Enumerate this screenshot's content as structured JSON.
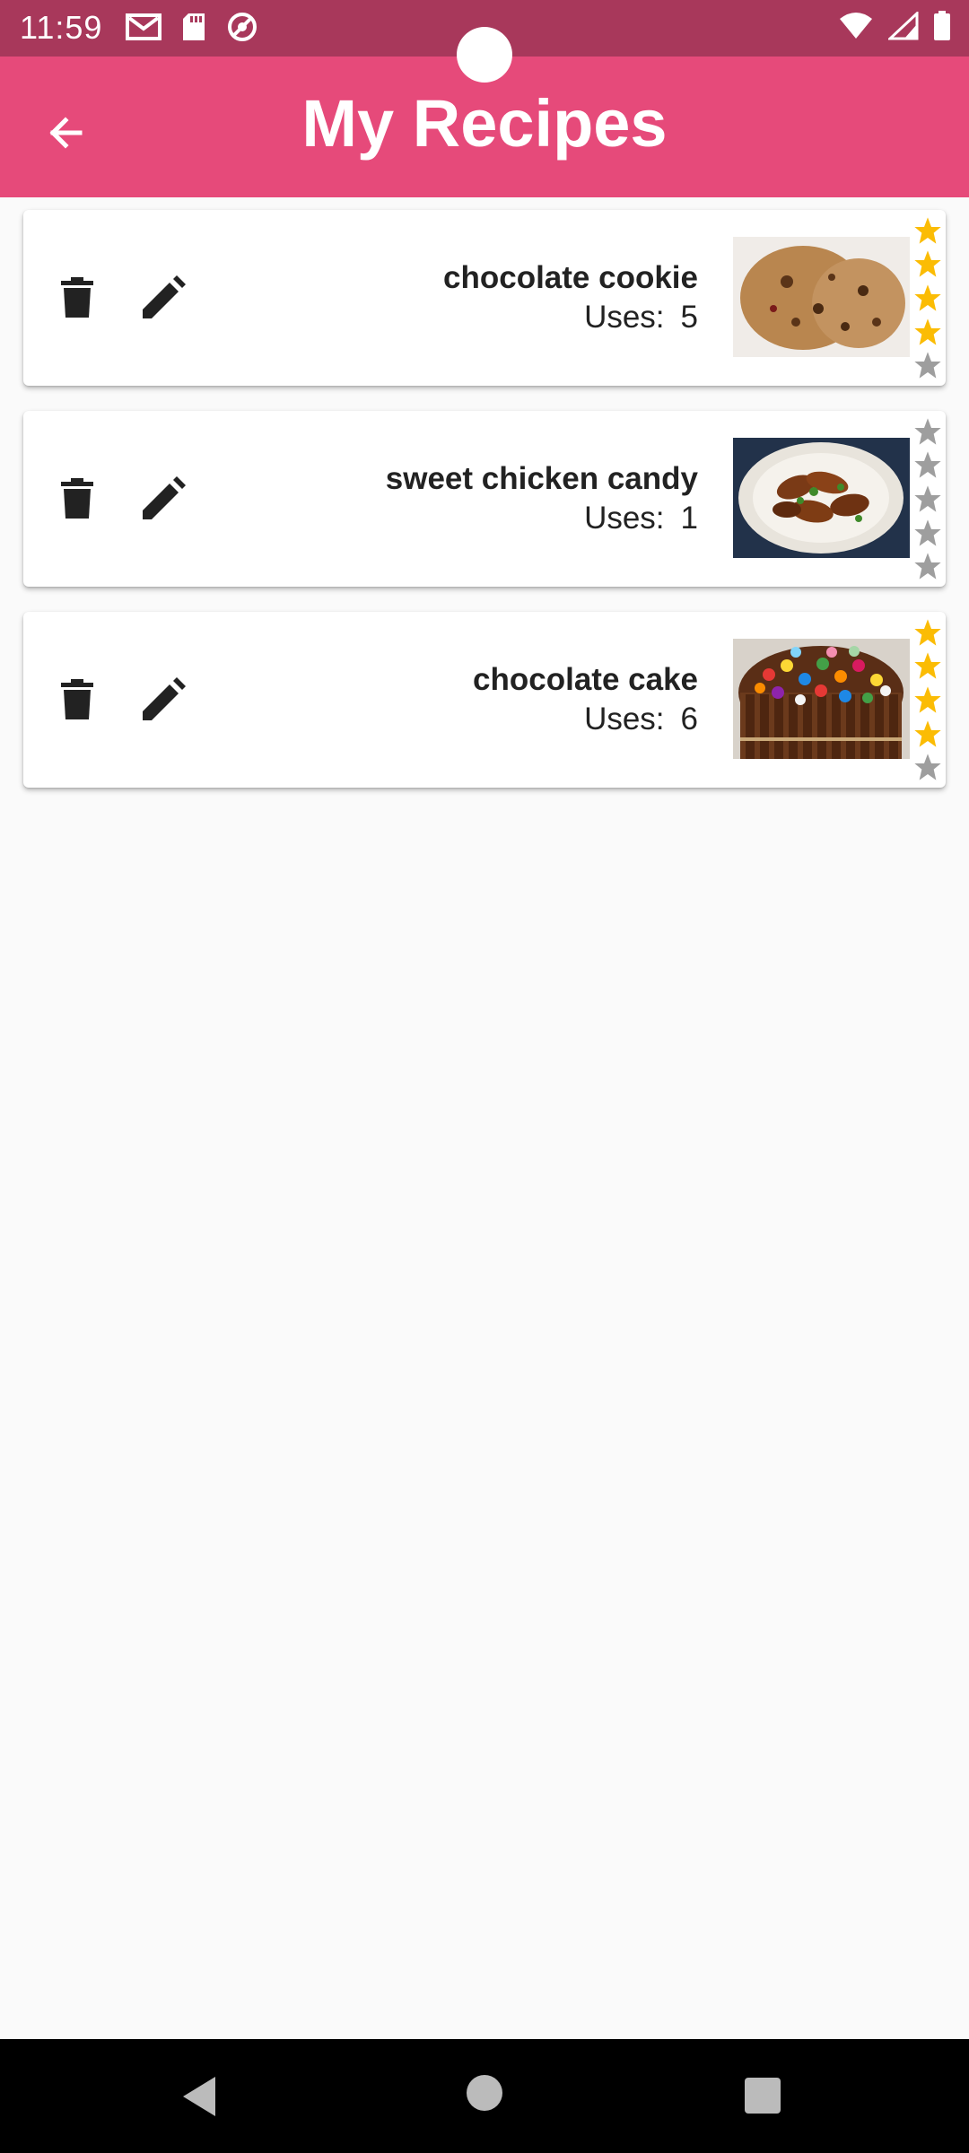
{
  "status_bar": {
    "time": "11:59"
  },
  "app_bar": {
    "title": "My Recipes"
  },
  "recipes": [
    {
      "name": "chocolate cookie",
      "uses_label": "Uses:",
      "uses": "5",
      "rating": 4,
      "max_rating": 5,
      "image": "chocolate-cookie-photo"
    },
    {
      "name": "sweet chicken candy",
      "uses_label": "Uses:",
      "uses": "1",
      "rating": 0,
      "max_rating": 5,
      "image": "sweet-chicken-candy-photo"
    },
    {
      "name": "chocolate cake",
      "uses_label": "Uses:",
      "uses": "6",
      "rating": 4,
      "max_rating": 5,
      "image": "chocolate-cake-photo"
    }
  ],
  "colors": {
    "status_bar": "#a8385b",
    "app_bar": "#e64a7a",
    "star_filled": "#fbbc04",
    "star_empty": "#9e9e9e"
  },
  "icons": {
    "back": "arrow-left-icon",
    "delete": "trash-icon",
    "edit": "pencil-icon",
    "star": "star-icon"
  }
}
